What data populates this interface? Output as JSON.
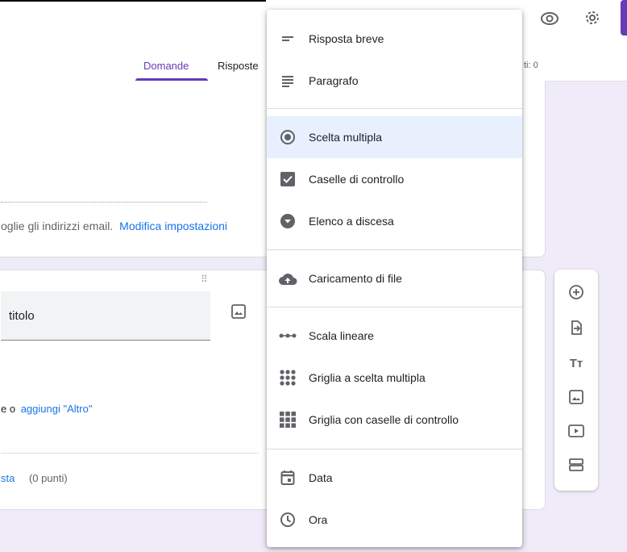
{
  "tabs": {
    "domande": "Domande",
    "risposte": "Risposte",
    "punti": "ti: 0"
  },
  "card1": {
    "email_note": "oglie gli indirizzi email.",
    "modify_link": "Modifica impostazioni"
  },
  "card2": {
    "title_input": "titolo",
    "add_option_prefix": "e o",
    "add_other": "aggiungi \"Altro\"",
    "answer_key": "sta",
    "points": "(0 punti)"
  },
  "menu": {
    "items": [
      {
        "label": "Risposta breve",
        "icon": "short-answer-icon"
      },
      {
        "label": "Paragrafo",
        "icon": "paragraph-icon"
      },
      {
        "label": "Scelta multipla",
        "icon": "radio-icon"
      },
      {
        "label": "Caselle di controllo",
        "icon": "checkbox-icon"
      },
      {
        "label": "Elenco a discesa",
        "icon": "dropdown-icon"
      },
      {
        "label": "Caricamento di file",
        "icon": "cloud-upload-icon"
      },
      {
        "label": "Scala lineare",
        "icon": "linear-scale-icon"
      },
      {
        "label": "Griglia a scelta multipla",
        "icon": "grid-dots-icon"
      },
      {
        "label": "Griglia con caselle di controllo",
        "icon": "grid-squares-icon"
      },
      {
        "label": "Data",
        "icon": "calendar-icon"
      },
      {
        "label": "Ora",
        "icon": "clock-icon"
      }
    ],
    "selected": "Scelta multipla"
  },
  "colors": {
    "accent": "#673ab7",
    "link": "#1a73e8",
    "selected_bg": "#e8f0fe"
  }
}
